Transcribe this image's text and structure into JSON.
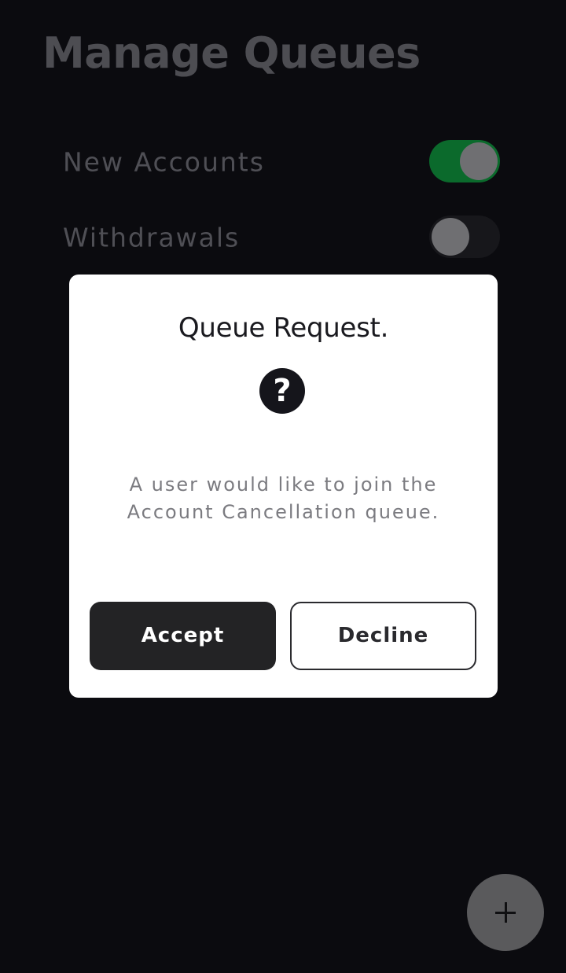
{
  "header": {
    "title": "Manage Queues"
  },
  "queues": [
    {
      "label": "New Accounts",
      "enabled": true
    },
    {
      "label": "Withdrawals",
      "enabled": false
    }
  ],
  "dialog": {
    "title": "Queue Request.",
    "icon": "question-circle-icon",
    "message": "A user would like to join the Account Cancellation queue.",
    "accept_label": "Accept",
    "decline_label": "Decline"
  },
  "fab": {
    "icon": "plus-icon"
  },
  "colors": {
    "background": "#0b0b0f",
    "toggle_on": "#0b6a2c",
    "dialog_bg": "#ffffff",
    "accept_bg": "#232325"
  }
}
